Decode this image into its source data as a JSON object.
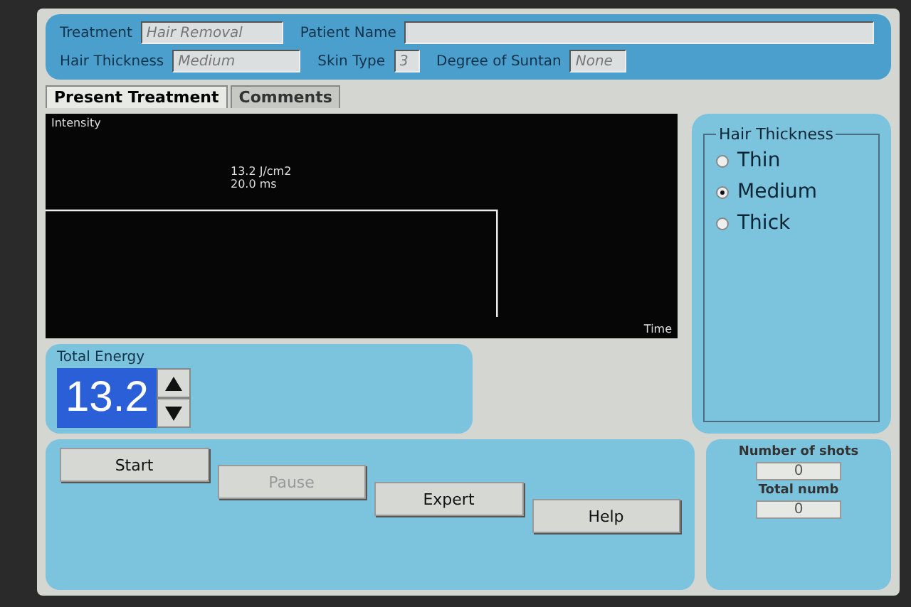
{
  "patient_info": {
    "fields": [
      {
        "label": "Treatment",
        "value": "Hair Removal"
      },
      {
        "label": "Patient Name"
      },
      {
        "label": "Hair Thickness",
        "value": "Medium"
      },
      {
        "label": "Skin Type",
        "value": "3"
      },
      {
        "label": "Degree of Suntan",
        "value": "None"
      }
    ]
  },
  "tabs": [
    {
      "label": "Present Treatment",
      "selected": true
    },
    {
      "label": "Comments",
      "selected": false
    }
  ],
  "pulse_graph": {
    "y_axis_label": "Intensity",
    "x_axis_label": "Time",
    "energy_label": "13.2 J/cm2",
    "duration_label": "20.0 ms"
  },
  "hair_thickness": {
    "title": "Hair Thickness",
    "options": [
      {
        "label": "Thin",
        "selected": false
      },
      {
        "label": "Medium",
        "selected": true
      },
      {
        "label": "Thick",
        "selected": false
      }
    ]
  },
  "total_energy": {
    "label": "Total Energy",
    "value": "13.2"
  },
  "buttons": [
    {
      "label": "Start",
      "disabled": false
    },
    {
      "label": "Pause",
      "disabled": true
    },
    {
      "label": "Expert",
      "disabled": false
    },
    {
      "label": "Help",
      "disabled": false
    }
  ],
  "counters": [
    {
      "label": "Number of shots",
      "value": "0"
    },
    {
      "label": "Total numb",
      "value": "0"
    }
  ]
}
